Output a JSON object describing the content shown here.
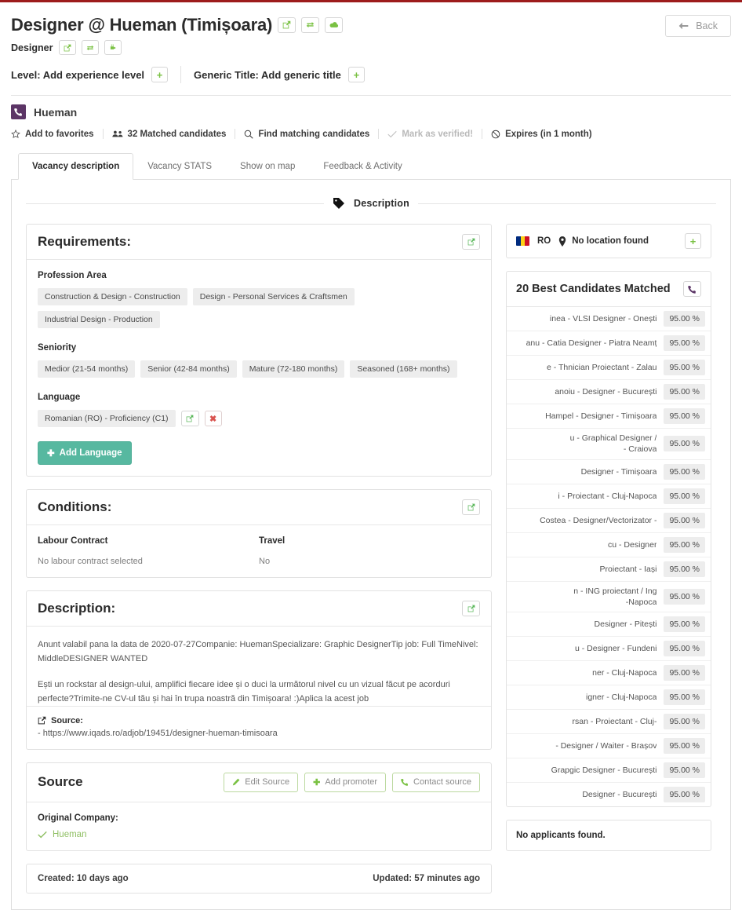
{
  "header": {
    "title": "Designer @ Hueman (Timișoara)",
    "subtitle": "Designer",
    "title_actions": [
      "edit-icon",
      "exchange-icon",
      "cloud-icon"
    ],
    "subtitle_actions": [
      "edit-icon",
      "exchange-icon",
      "plug-icon"
    ],
    "level_label": "Level: Add experience level",
    "generic_title_label": "Generic Title: Add generic title",
    "back_label": "Back"
  },
  "company": {
    "name": "Hueman",
    "logo_color": "#5c3566"
  },
  "actions": [
    {
      "label": "Add to favorites",
      "icon": "star-icon",
      "muted": false
    },
    {
      "label": "32 Matched candidates",
      "icon": "users-icon",
      "muted": false
    },
    {
      "label": "Find matching candidates",
      "icon": "search-icon",
      "muted": false
    },
    {
      "label": "Mark as verified!",
      "icon": "check-icon",
      "muted": true
    },
    {
      "label": "Expires (in 1 month)",
      "icon": "ban-icon",
      "muted": false
    }
  ],
  "tabs": [
    {
      "label": "Vacancy description",
      "active": true
    },
    {
      "label": "Vacancy STATS",
      "active": false
    },
    {
      "label": "Show on map",
      "active": false
    },
    {
      "label": "Feedback & Activity",
      "active": false
    }
  ],
  "section": {
    "title": "Description",
    "icon": "tag-icon"
  },
  "requirements": {
    "title": "Requirements:",
    "profession_area_label": "Profession Area",
    "profession_areas": [
      "Construction & Design - Construction",
      "Design - Personal Services & Craftsmen",
      "Industrial Design - Production"
    ],
    "seniority_label": "Seniority",
    "seniorities": [
      "Medior (21-54 months)",
      "Senior (42-84 months)",
      "Mature (72-180 months)",
      "Seasoned (168+ months)"
    ],
    "language_label": "Language",
    "languages": [
      "Romanian (RO) - Proficiency (C1)"
    ],
    "add_language_label": "Add Language"
  },
  "conditions": {
    "title": "Conditions:",
    "labour_contract_label": "Labour Contract",
    "labour_contract_value": "No labour contract selected",
    "travel_label": "Travel",
    "travel_value": "No"
  },
  "description": {
    "title": "Description:",
    "paragraph1": "Anunt valabil pana la data de 2020-07-27Companie: HuemanSpecializare: Graphic DesignerTip job: Full TimeNivel: MiddleDESIGNER WANTED",
    "paragraph2": "Ești un rockstar al design-ului, amplifici fiecare idee și o duci la următorul nivel cu un vizual făcut pe acorduri perfecte?Trimite-ne CV-ul tău și hai în trupa noastră din Timișoara! :)Aplica la acest job",
    "source_label": "Source:",
    "source_url": "- https://www.iqads.ro/adjob/19451/designer-hueman-timisoara"
  },
  "source": {
    "title": "Source",
    "edit_source_label": "Edit Source",
    "add_promoter_label": "Add promoter",
    "contact_source_label": "Contact source",
    "original_company_label": "Original Company:",
    "original_company_value": "Hueman"
  },
  "timestamps": {
    "created": "Created: 10 days ago",
    "updated": "Updated: 57 minutes ago"
  },
  "location": {
    "country_code": "RO",
    "text": "No location found",
    "add_label": "+"
  },
  "candidates": {
    "title": "20 Best Candidates Matched",
    "call_icon": "phone-icon",
    "rows": [
      {
        "name": "inea - VLSI Designer - Onești",
        "pct": "95.00 %"
      },
      {
        "name": "anu - Catia Designer - Piatra Neamț",
        "pct": "95.00 %"
      },
      {
        "name": "e - Thnician Proiectant - Zalau",
        "pct": "95.00 %"
      },
      {
        "name": "anoiu - Designer - București",
        "pct": "95.00 %"
      },
      {
        "name": "Hampel - Designer - Timișoara",
        "pct": "95.00 %"
      },
      {
        "name": "u - Graphical Designer /\n - Craiova",
        "pct": "95.00 %"
      },
      {
        "name": "Designer - Timișoara",
        "pct": "95.00 %"
      },
      {
        "name": "i - Proiectant - Cluj-Napoca",
        "pct": "95.00 %"
      },
      {
        "name": "Costea - Designer/Vectorizator -",
        "pct": "95.00 %"
      },
      {
        "name": "cu - Designer",
        "pct": "95.00 %"
      },
      {
        "name": "Proiectant - Iași",
        "pct": "95.00 %"
      },
      {
        "name": "n - ING proiectant / Ing\n-Napoca",
        "pct": "95.00 %"
      },
      {
        "name": "Designer - Pitești",
        "pct": "95.00 %"
      },
      {
        "name": "u - Designer - Fundeni",
        "pct": "95.00 %"
      },
      {
        "name": "ner - Cluj-Napoca",
        "pct": "95.00 %"
      },
      {
        "name": "igner - Cluj-Napoca",
        "pct": "95.00 %"
      },
      {
        "name": "rsan - Proiectant - Cluj-",
        "pct": "95.00 %"
      },
      {
        "name": "- Designer / Waiter - Brașov",
        "pct": "95.00 %"
      },
      {
        "name": "Grapgic Designer - București",
        "pct": "95.00 %"
      },
      {
        "name": "Designer - București",
        "pct": "95.00 %"
      }
    ]
  },
  "applicants": {
    "empty_text": "No applicants found."
  },
  "colors": {
    "green": "#7ac143",
    "teal": "#57b8a0",
    "purple": "#5c3566",
    "top_rule": "#9d1c1c"
  }
}
